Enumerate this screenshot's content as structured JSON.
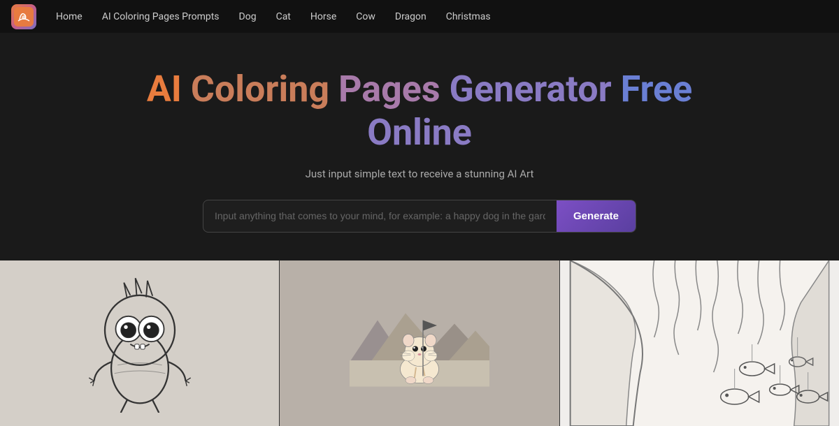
{
  "nav": {
    "logo_alt": "AI Coloring Pages Logo",
    "links": [
      {
        "label": "Home",
        "href": "#"
      },
      {
        "label": "AI Coloring Pages Prompts",
        "href": "#"
      },
      {
        "label": "Dog",
        "href": "#"
      },
      {
        "label": "Cat",
        "href": "#"
      },
      {
        "label": "Horse",
        "href": "#"
      },
      {
        "label": "Cow",
        "href": "#"
      },
      {
        "label": "Dragon",
        "href": "#"
      },
      {
        "label": "Christmas",
        "href": "#"
      }
    ]
  },
  "hero": {
    "title_line1": "AI Coloring Pages Generator Free",
    "title_line2": "Online",
    "subtitle": "Just input simple text to receive a stunning AI Art",
    "input_placeholder": "Input anything that comes to your mind, for example: a happy dog in the garden",
    "generate_button": "Generate"
  },
  "images": [
    {
      "alt": "Cute alien creature coloring page"
    },
    {
      "alt": "Hamster with flag in desert coloring page"
    },
    {
      "alt": "Cave with hanging fish coloring page"
    }
  ]
}
